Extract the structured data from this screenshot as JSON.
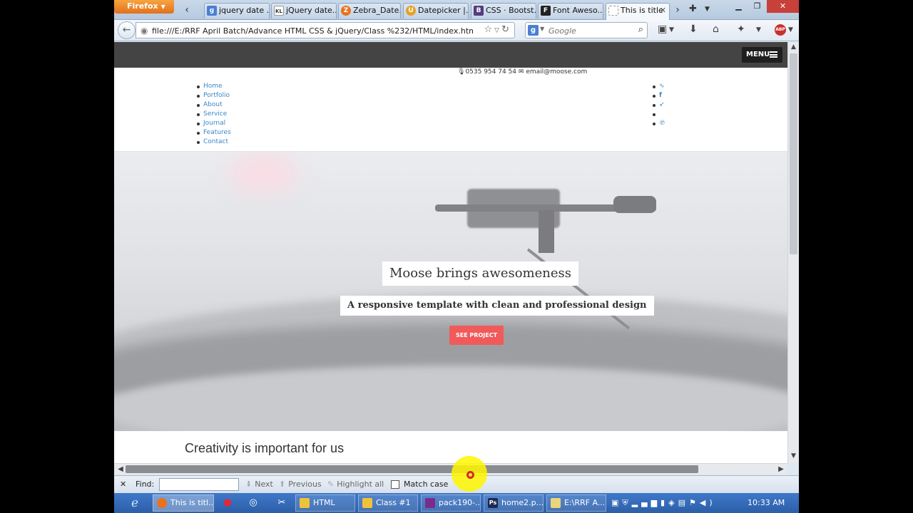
{
  "browser": {
    "app_button": "Firefox",
    "tabs": [
      {
        "label": "jquery date ...",
        "icon_text": "g",
        "icon_color": "#4a7fd4"
      },
      {
        "label": "jQuery date...",
        "icon_text": "KL",
        "icon_color": "#333333"
      },
      {
        "label": "Zebra_Date...",
        "icon_text": "Z",
        "icon_color": "#e8731c"
      },
      {
        "label": "Datepicker |...",
        "icon_text": "U",
        "icon_color": "#e5a126"
      },
      {
        "label": "CSS · Bootst...",
        "icon_text": "B",
        "icon_color": "#563d7c"
      },
      {
        "label": "Font Aweso...",
        "icon_text": "F",
        "icon_color": "#222222"
      },
      {
        "label": "This is title",
        "icon_text": "",
        "icon_color": "#ffffff"
      }
    ],
    "url": "file:///E:/RRF April Batch/Advance HTML CSS & jQuery/Class %232/HTML/index.html",
    "search_placeholder": "Google",
    "search_engine": "g",
    "adblock": "ABP"
  },
  "page": {
    "menu_label": "MENU",
    "phone": "0535 954 74 54",
    "email": "email@moose.com",
    "nav": [
      "Home",
      "Portfolio",
      "About",
      "Service",
      "Journal",
      "Features",
      "Contact"
    ],
    "social_icons": [
      "rss-icon",
      "facebook-icon",
      "twitter-icon",
      "",
      "pinterest-icon"
    ],
    "hero_title": "Moose brings awesomeness",
    "hero_subtitle": "A responsive template with clean and professional design",
    "hero_button": "SEE PROJECT",
    "section_title": "Creativity is important for us",
    "accent_color": "#f05a5a",
    "link_color": "#3a87c8"
  },
  "findbar": {
    "label": "Find:",
    "value": "",
    "next": "Next",
    "previous": "Previous",
    "highlight": "Highlight all",
    "match_case": "Match case"
  },
  "taskbar": {
    "tasks": [
      {
        "label": "This is titl...",
        "icon_color": "#e8731c"
      },
      {
        "label": "HTML",
        "icon_color": "#f0c23a"
      },
      {
        "label": "Class #1",
        "icon_color": "#f0c23a"
      },
      {
        "label": "pack190-...",
        "icon_color": "#7a2c8c"
      },
      {
        "label": "home2.p...",
        "icon_text": "Ps",
        "icon_color": "#1c2a52"
      },
      {
        "label": "E:\\RRF A...",
        "icon_color": "#e9d57a"
      }
    ],
    "clock": "10:33 AM"
  }
}
